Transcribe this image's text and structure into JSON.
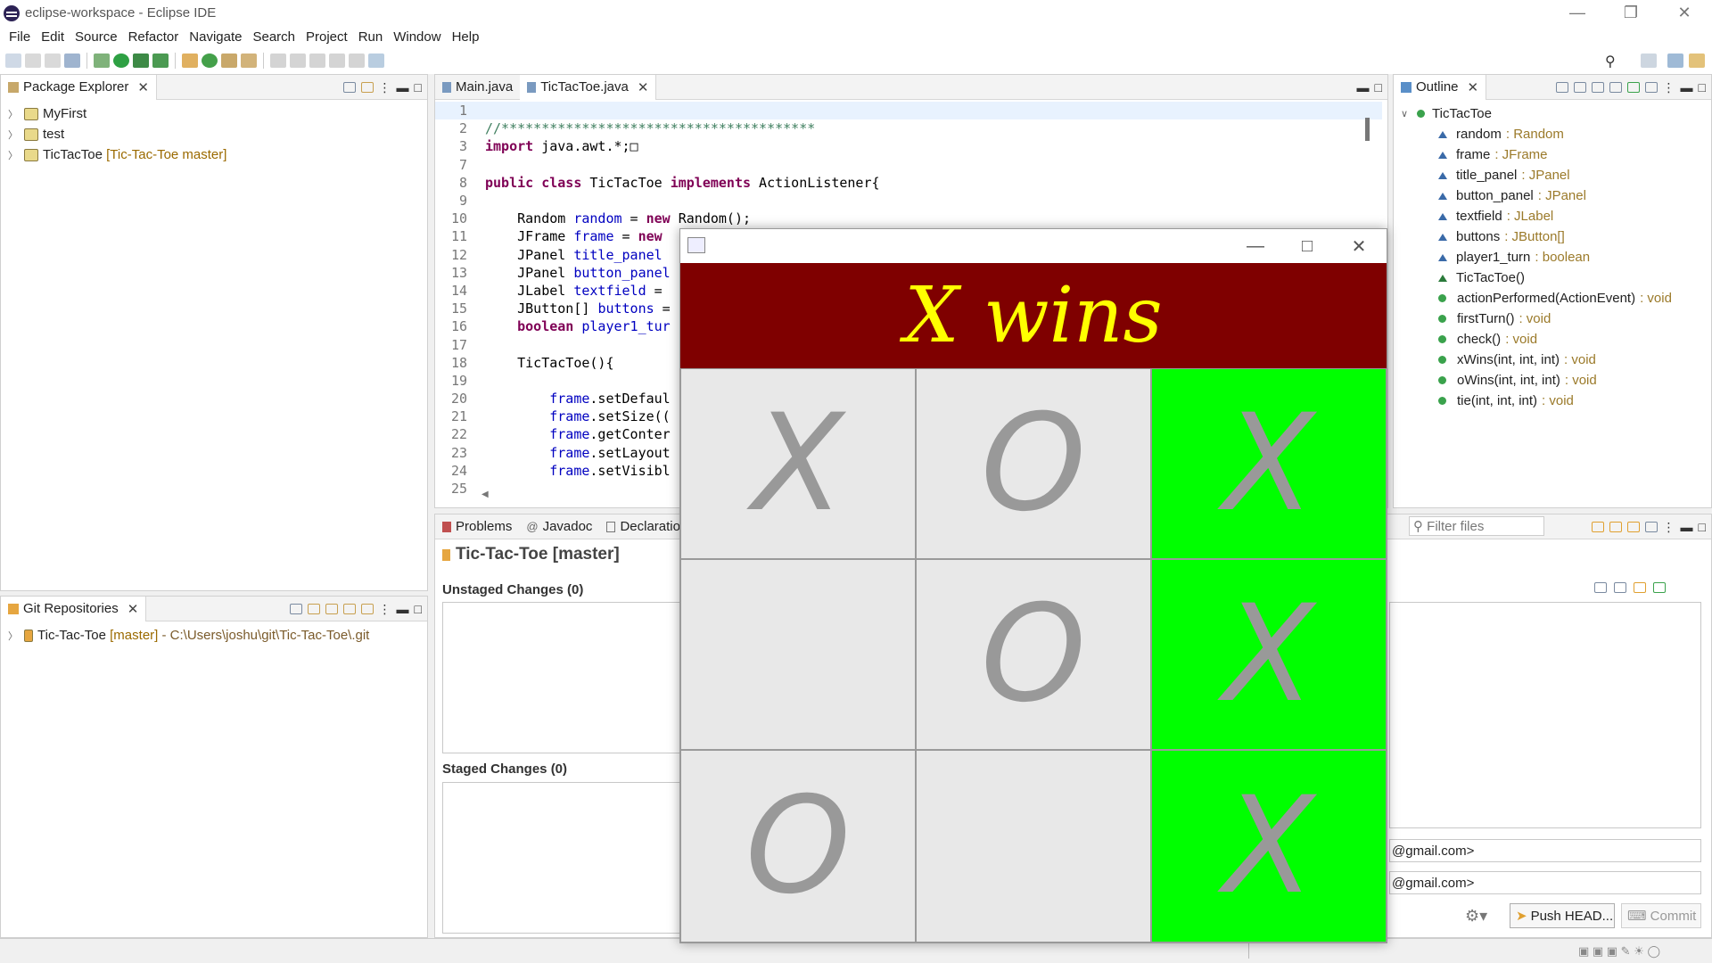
{
  "window": {
    "title": "eclipse-workspace - Eclipse IDE"
  },
  "menu": [
    "File",
    "Edit",
    "Source",
    "Refactor",
    "Navigate",
    "Search",
    "Project",
    "Run",
    "Window",
    "Help"
  ],
  "package_explorer": {
    "tab": "Package Explorer",
    "items": [
      {
        "name": "MyFirst",
        "decoration": ""
      },
      {
        "name": "test",
        "decoration": ""
      },
      {
        "name": "TicTacToe",
        "decoration": "[Tic-Tac-Toe master]"
      }
    ]
  },
  "git_repositories": {
    "tab": "Git Repositories",
    "items": [
      {
        "name": "Tic-Tac-Toe",
        "branch": "[master]",
        "path": "- C:\\Users\\joshu\\git\\Tic-Tac-Toe\\.git"
      }
    ]
  },
  "editor": {
    "tabs": [
      "Main.java",
      "TicTacToe.java"
    ],
    "lines": [
      {
        "n": "1",
        "html": ""
      },
      {
        "n": "2",
        "html": "<span class='cm'>//***************************************</span>"
      },
      {
        "n": "3",
        "html": "<span class='kw'>import</span> java.awt.*;&#9633;"
      },
      {
        "n": "7",
        "html": ""
      },
      {
        "n": "8",
        "html": "<span class='kw'>public class</span> TicTacToe <span class='kw'>implements</span> ActionListener{"
      },
      {
        "n": "9",
        "html": ""
      },
      {
        "n": "10",
        "html": "    Random <span class='fld'>random</span> = <span class='kw'>new</span> Random();"
      },
      {
        "n": "11",
        "html": "    JFrame <span class='fld'>frame</span> = <span class='kw'>new</span>"
      },
      {
        "n": "12",
        "html": "    JPanel <span class='fld'>title_panel</span>"
      },
      {
        "n": "13",
        "html": "    JPanel <span class='fld'>button_panel</span>"
      },
      {
        "n": "14",
        "html": "    JLabel <span class='fld'>textfield</span> ="
      },
      {
        "n": "15",
        "html": "    JButton[] <span class='fld'>buttons</span> ="
      },
      {
        "n": "16",
        "html": "    <span class='kw'>boolean</span> <span class='fld'>player1_tur</span>"
      },
      {
        "n": "17",
        "html": ""
      },
      {
        "n": "18",
        "html": "    TicTacToe(){"
      },
      {
        "n": "19",
        "html": ""
      },
      {
        "n": "20",
        "html": "        <span class='fld'>frame</span>.setDefaul"
      },
      {
        "n": "21",
        "html": "        <span class='fld'>frame</span>.setSize(("
      },
      {
        "n": "22",
        "html": "        <span class='fld'>frame</span>.getConter"
      },
      {
        "n": "23",
        "html": "        <span class='fld'>frame</span>.setLayout"
      },
      {
        "n": "24",
        "html": "        <span class='fld'>frame</span>.setVisibl"
      },
      {
        "n": "25",
        "html": ""
      }
    ]
  },
  "outline": {
    "tab": "Outline",
    "root": "TicTacToe",
    "fields": [
      {
        "name": "random",
        "type": ": Random"
      },
      {
        "name": "frame",
        "type": ": JFrame"
      },
      {
        "name": "title_panel",
        "type": ": JPanel"
      },
      {
        "name": "button_panel",
        "type": ": JPanel"
      },
      {
        "name": "textfield",
        "type": ": JLabel"
      },
      {
        "name": "buttons",
        "type": ": JButton[]"
      },
      {
        "name": "player1_turn",
        "type": ": boolean"
      }
    ],
    "constructor": "TicTacToe()",
    "methods": [
      {
        "name": "actionPerformed(ActionEvent)",
        "type": ": void"
      },
      {
        "name": "firstTurn()",
        "type": ": void"
      },
      {
        "name": "check()",
        "type": ": void"
      },
      {
        "name": "xWins(int, int, int)",
        "type": ": void"
      },
      {
        "name": "oWins(int, int, int)",
        "type": ": void"
      },
      {
        "name": "tie(int, int, int)",
        "type": ": void"
      }
    ]
  },
  "bottom": {
    "tabs": [
      "Problems",
      "Javadoc",
      "Declaration"
    ],
    "filter_placeholder": "Filter files",
    "staging_title": "Tic-Tac-Toe [master]",
    "unstaged": "Unstaged Changes (0)",
    "staged": "Staged Changes (0)",
    "author": "@gmail.com>",
    "committer": "@gmail.com>",
    "push_button": "Push HEAD...",
    "commit_button": "Commit"
  },
  "game": {
    "banner": "X wins",
    "banner_color": "#7f0000",
    "banner_text_color": "#ffff00",
    "win_color": "#00ff00",
    "cells": [
      "X",
      "O",
      "X",
      "",
      "O",
      "X",
      "O",
      "",
      "X"
    ],
    "winning_cells": [
      2,
      5,
      8
    ]
  }
}
